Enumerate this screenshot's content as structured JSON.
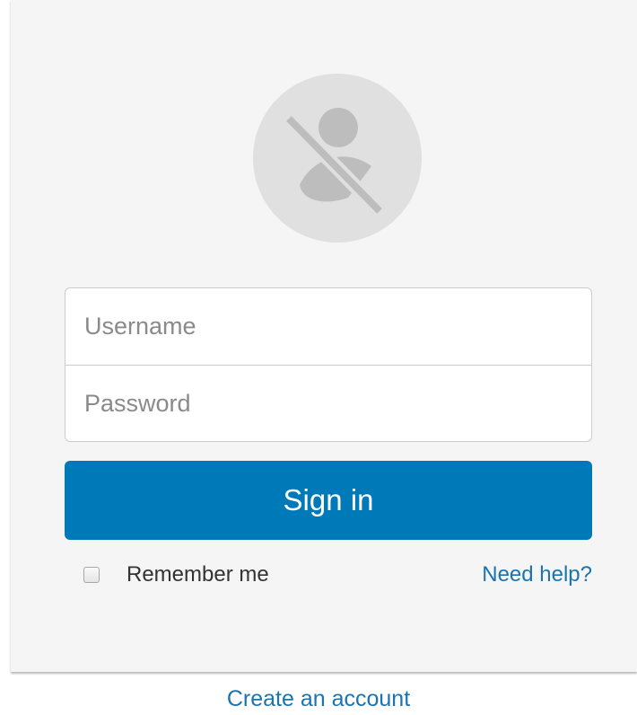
{
  "login": {
    "username_placeholder": "Username",
    "password_placeholder": "Password",
    "signin_label": "Sign in",
    "remember_label": "Remember me",
    "remember_checked": false,
    "help_link": "Need help?",
    "avatar_icon": "no-user-avatar-icon"
  },
  "footer": {
    "create_account": "Create an account"
  },
  "colors": {
    "primary": "#0079b8",
    "link": "#1b74b0",
    "card_bg": "#f5f5f5",
    "avatar_bg": "#e0e0e0",
    "avatar_fg": "#bdbdbd"
  }
}
